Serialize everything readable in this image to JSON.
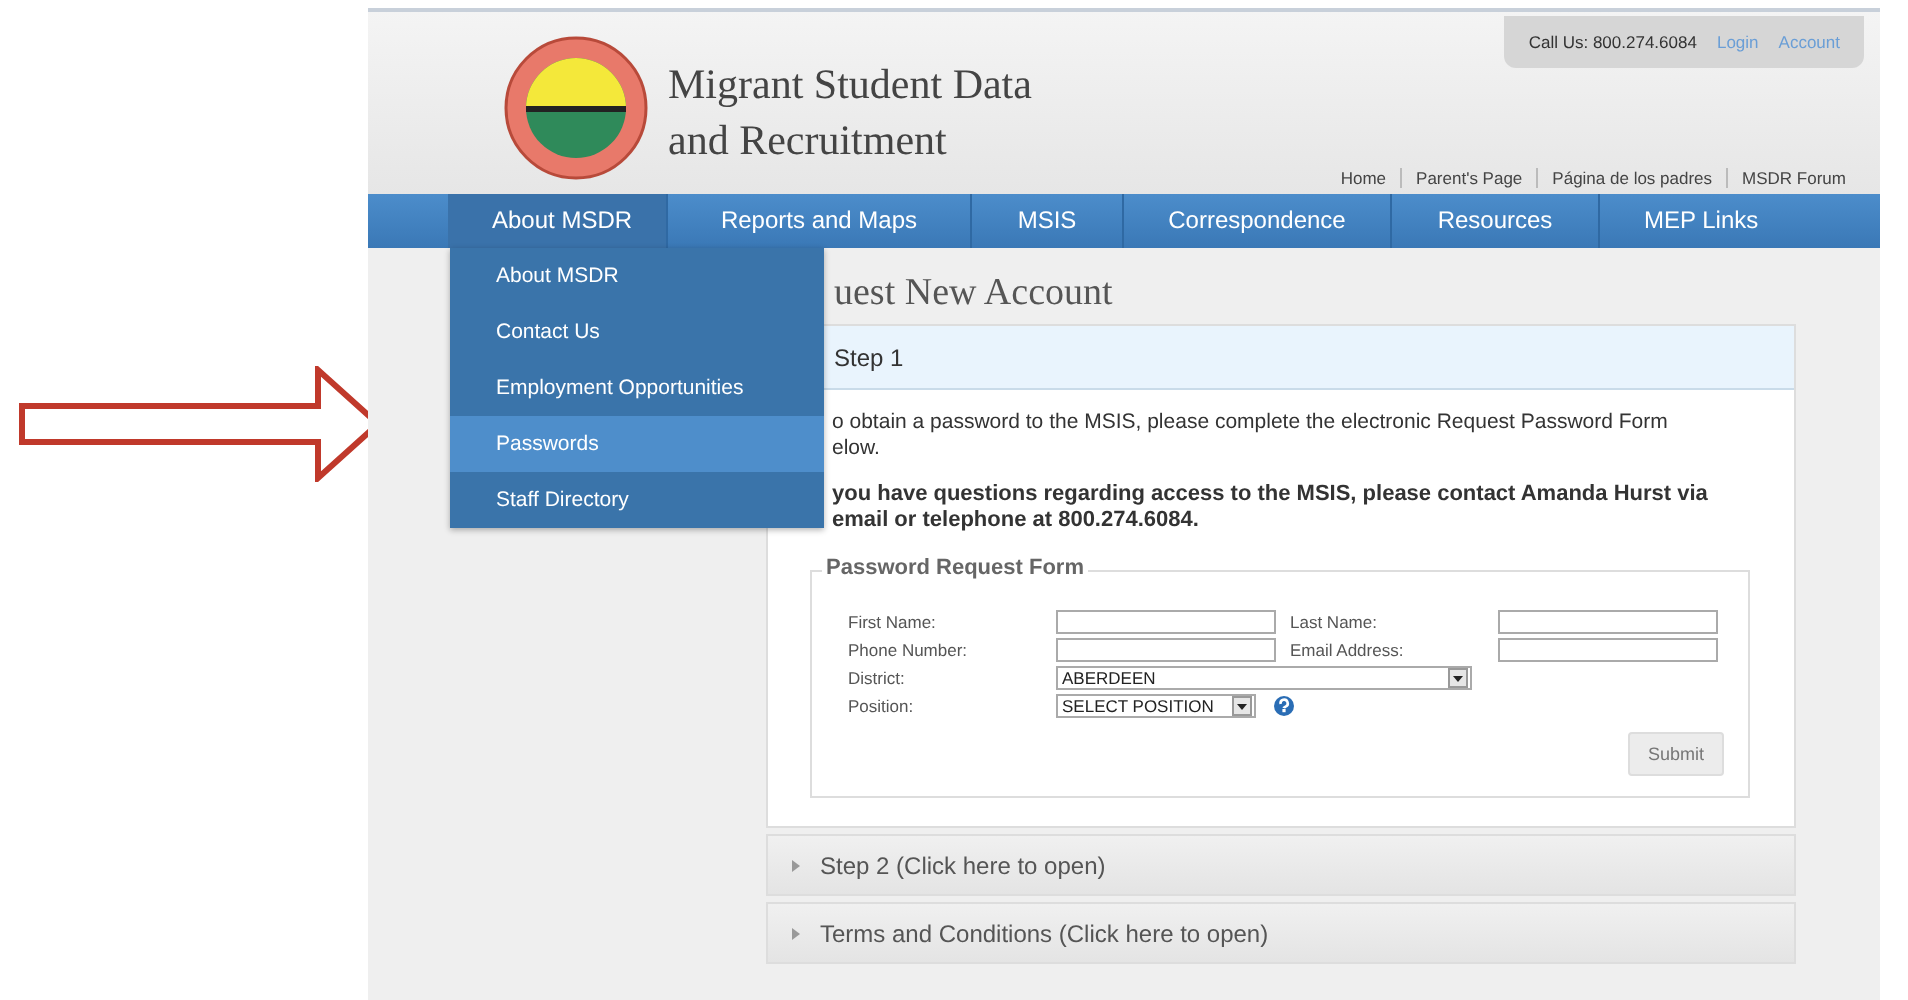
{
  "header": {
    "title_lines": [
      "Migrant Student Data",
      "and Recruitment"
    ],
    "call_us": "Call Us: 800.274.6084",
    "account_links": [
      "Login",
      "Account"
    ],
    "top_links": [
      "Home",
      "Parent's Page",
      "Página de los padres",
      "MSDR Forum"
    ]
  },
  "nav": [
    {
      "label": "About MSDR",
      "open": true
    },
    {
      "label": "Reports and Maps",
      "open": false
    },
    {
      "label": "MSIS",
      "open": false
    },
    {
      "label": "Correspondence",
      "open": false
    },
    {
      "label": "Resources",
      "open": false
    },
    {
      "label": "MEP Links",
      "open": false
    }
  ],
  "dropdown": [
    {
      "label": "About MSDR",
      "selected": false
    },
    {
      "label": "Contact Us",
      "selected": false
    },
    {
      "label": "Employment Opportunities",
      "selected": false
    },
    {
      "label": "Passwords",
      "selected": true
    },
    {
      "label": "Staff Directory",
      "selected": false
    }
  ],
  "page_title": "uest New Account",
  "step1": {
    "title": "Step 1",
    "intro_lines": [
      "o obtain a password to the MSIS, please complete the electronic Request Password Form",
      "elow."
    ],
    "contact_lines": [
      "you have questions regarding access to the MSIS, please contact Amanda Hurst via",
      "email or telephone at 800.274.6084."
    ],
    "form": {
      "legend": "Password Request Form",
      "rows": [
        {
          "fields": [
            {
              "label": "First Name:",
              "kind": "text"
            },
            {
              "label": "Last Name:",
              "kind": "text"
            }
          ]
        },
        {
          "fields": [
            {
              "label": "Phone Number:",
              "kind": "text"
            },
            {
              "label": "Email Address:",
              "kind": "text"
            }
          ]
        },
        {
          "fields": [
            {
              "label": "District:",
              "kind": "select",
              "value": "ABERDEEN",
              "wide": true
            }
          ]
        },
        {
          "fields": [
            {
              "label": "Position:",
              "kind": "select",
              "value": "SELECT POSITION",
              "wide": false,
              "help": true
            }
          ]
        }
      ],
      "submit": "Submit"
    }
  },
  "collapsed_steps": [
    "Step 2 (Click here to open)",
    "Terms and Conditions (Click here to open)"
  ]
}
